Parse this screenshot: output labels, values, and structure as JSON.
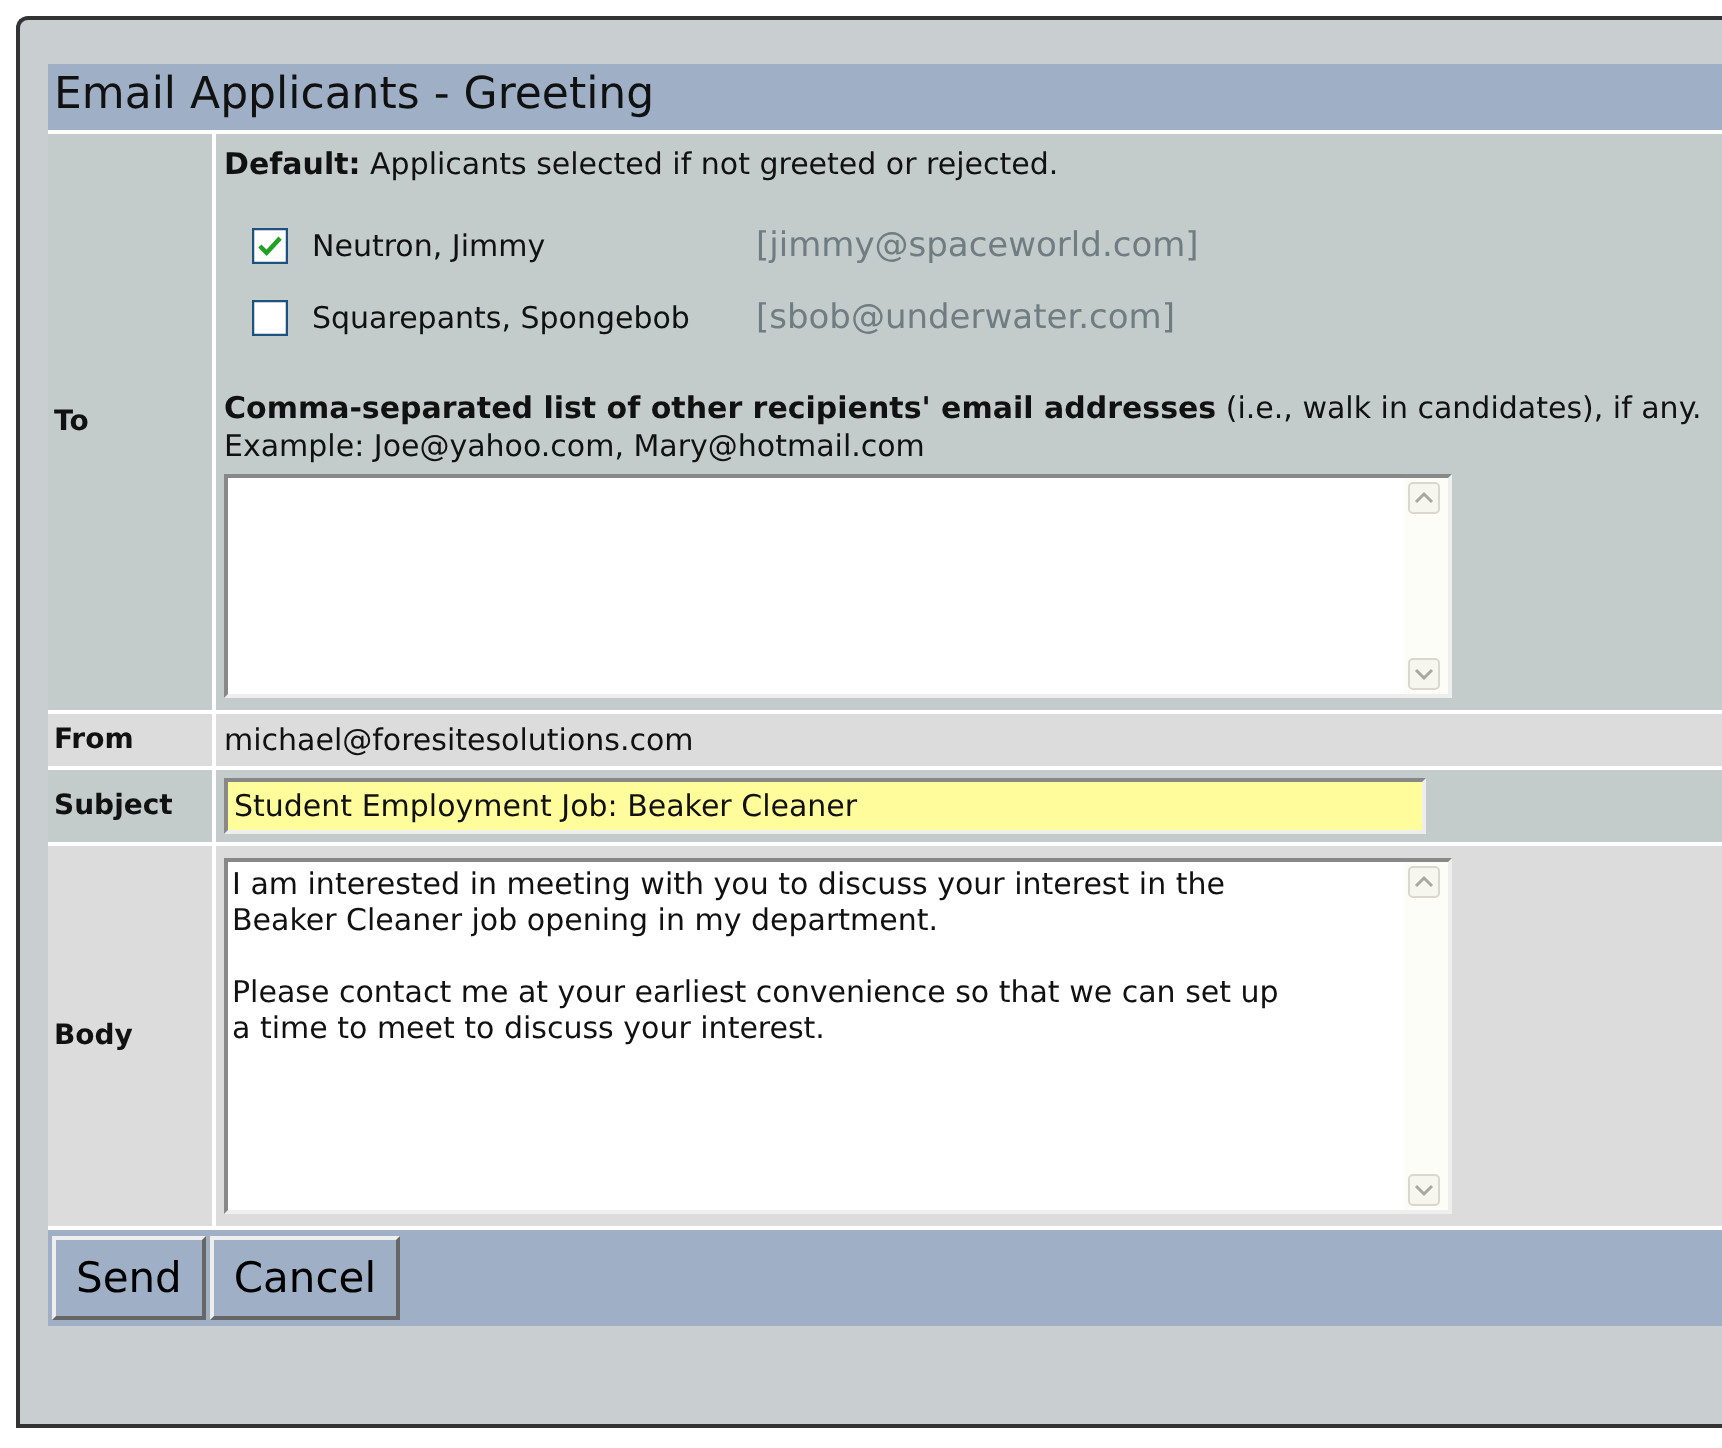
{
  "title": "Email Applicants - Greeting",
  "to": {
    "label": "To",
    "default_label": "Default:",
    "default_text": "Applicants selected if not greeted or rejected.",
    "applicants": [
      {
        "name": "Neutron, Jimmy",
        "email": "[jimmy@spaceworld.com]",
        "checked": true
      },
      {
        "name": "Squarepants, Spongebob",
        "email": "[sbob@underwater.com]",
        "checked": false
      }
    ],
    "other_note": "**Comma-separated list of other recipients' email addresses** (i.e., walk in candidates), if any.",
    "example": "Example: Joe@yahoo.com, Mary@hotmail.com"
  },
  "from": {
    "label": "From",
    "value": "michael@foresitesolutions.com"
  },
  "subject": {
    "label": "Subject",
    "value": "Student Employment Job: Beaker Cleaner"
  },
  "body": {
    "label": "Body",
    "value": "I am interested in meeting with you to discuss your interest in the Beaker Cleaner job opening in my department.\n\nPlease contact me at your earliest convenience so that we can set up a time to meet to discuss your interest."
  },
  "buttons": [
    "Send",
    "Cancel"
  ]
}
